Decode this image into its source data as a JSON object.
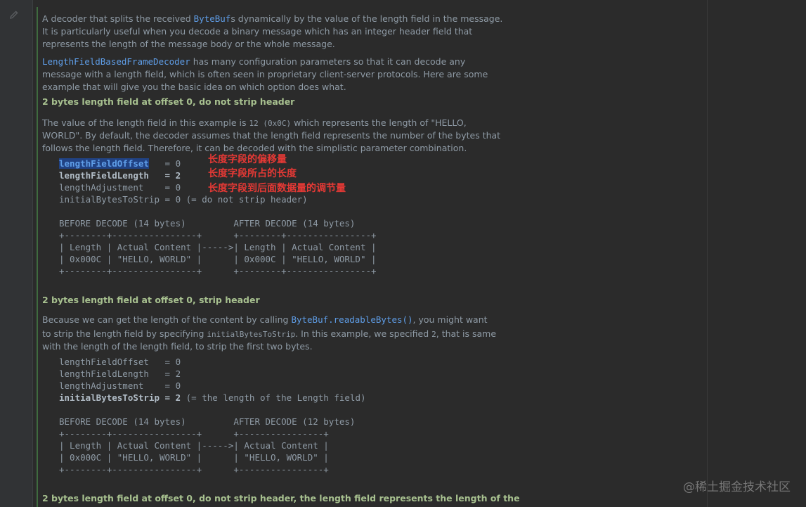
{
  "doc": {
    "p1": {
      "t1": "A decoder that splits the received ",
      "c1": "ByteBuf",
      "t2": "s dynamically by the value of the length field in the message.",
      "l2": "It is particularly useful when you decode a binary message which has an integer header field that",
      "l3": "represents the length of the message body or the whole message."
    },
    "p2": {
      "c1": "LengthFieldBasedFrameDecoder",
      "t1": " has many configuration parameters so that it can decode any",
      "l2": "message with a length field, which is often seen in proprietary client-server protocols. Here are some",
      "l3": "example that will give you the basic idea on which option does what."
    },
    "h1": "2 bytes length field at offset 0, do not strip header",
    "p3": {
      "t1": "The value of the length field in this example is ",
      "code": "12 (0x0C)",
      "t2": " which represents the length of \"HELLO,",
      "l2": "WORLD\". By default, the decoder assumes that the length field represents the number of the bytes that",
      "l3": "follows the length field. Therefore, it can be decoded with the simplistic parameter combination."
    },
    "code1": {
      "r1a": "lengthFieldOffset",
      "r1b": "   = 0",
      "r2a": "lengthFieldLength",
      "r2b": "   = 2",
      "r3": "lengthAdjustment    = 0",
      "r4": "initialBytesToStrip = 0 (= do not strip header)",
      "table": "BEFORE DECODE (14 bytes)         AFTER DECODE (14 bytes)\n+--------+----------------+      +--------+----------------+\n| Length | Actual Content |----->| Length | Actual Content |\n| 0x000C | \"HELLO, WORLD\" |      | 0x000C | \"HELLO, WORLD\" |\n+--------+----------------+      +--------+----------------+"
    },
    "annotations": [
      "长度字段的偏移量",
      "长度字段所占的长度",
      "长度字段到后面数据量的调节量"
    ],
    "h2": "2 bytes length field at offset 0, strip header",
    "p4": {
      "t1": "Because we can get the length of the content by calling ",
      "c1": "ByteBuf.readableBytes()",
      "t2": ", you might want",
      "l2a": "to strip the length field by specifying ",
      "l2code1": "initialBytesToStrip",
      "l2b": ". In this example, we specified ",
      "l2code2": "2",
      "l2c": ", that is same",
      "l3": "with the length of the length field, to strip the first two bytes."
    },
    "code2": {
      "r1": "lengthFieldOffset   = 0",
      "r2": "lengthFieldLength   = 2",
      "r3": "lengthAdjustment    = 0",
      "r4a": "initialBytesToStrip = 2",
      "r4b": " (= the length of the Length field)",
      "table": "BEFORE DECODE (14 bytes)         AFTER DECODE (12 bytes)\n+--------+----------------+      +----------------+\n| Length | Actual Content |----->| Actual Content |\n| 0x000C | \"HELLO, WORLD\" |      | \"HELLO, WORLD\" |\n+--------+----------------+      +----------------+"
    },
    "h3": "2 bytes length field at offset 0, do not strip header, the length field represents the length of the"
  },
  "watermark": "@稀土掘金技术社区"
}
